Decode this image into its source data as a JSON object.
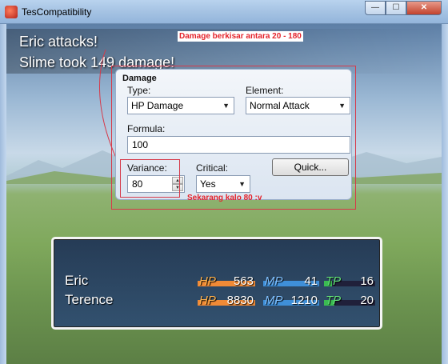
{
  "window": {
    "title": "TesCompatibility",
    "minimize": "—",
    "maximize": "☐",
    "close": "✕"
  },
  "battle_message": {
    "line1": "Eric attacks!",
    "line2": "Slime took 149 damage!"
  },
  "annotations": {
    "note_top": "Damage berkisar antara 20 - 180",
    "note_bottom": "Sekarang kalo 80 :v"
  },
  "damage_dialog": {
    "title": "Damage",
    "type_label": "Type:",
    "type_value": "HP Damage",
    "element_label": "Element:",
    "element_value": "Normal Attack",
    "formula_label": "Formula:",
    "formula_value": "100",
    "variance_label": "Variance:",
    "variance_value": "80",
    "critical_label": "Critical:",
    "critical_value": "Yes",
    "quick_button": "Quick..."
  },
  "party": [
    {
      "name": "Eric",
      "hp_label": "HP",
      "hp_value": "563",
      "hp_fraction": 1.0,
      "mp_label": "MP",
      "mp_value": "41",
      "mp_fraction": 1.0,
      "tp_label": "TP",
      "tp_value": "16",
      "tp_fraction": 0.16
    },
    {
      "name": "Terence",
      "hp_label": "HP",
      "hp_value": "8830",
      "hp_fraction": 1.0,
      "mp_label": "MP",
      "mp_value": "1210",
      "mp_fraction": 1.0,
      "tp_label": "TP",
      "tp_value": "20",
      "tp_fraction": 0.2
    }
  ],
  "colors": {
    "hp_gauge": "#f08a36",
    "mp_gauge": "#3f8fd8",
    "tp_gauge": "#3bbb52",
    "annotation_red": "#e4232b"
  }
}
